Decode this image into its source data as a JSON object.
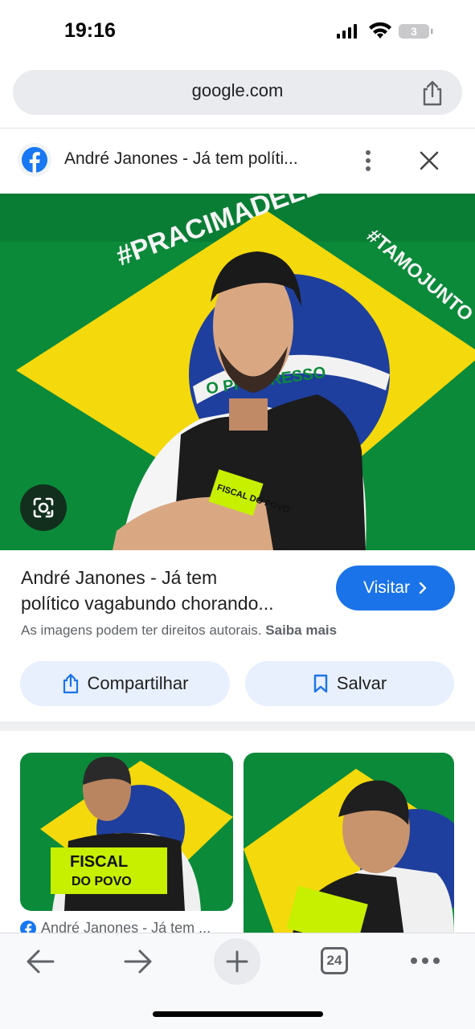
{
  "status": {
    "time": "19:16",
    "battery": "3"
  },
  "url": {
    "domain": "google.com"
  },
  "source": {
    "title": "André Janones - Já tem políti..."
  },
  "image": {
    "flag_text_1": "#PRACIMADELES",
    "flag_text_2": "#TAMOJUNTO",
    "flag_motto": "O PROGRESSO",
    "vest_text": "FISCAL DO POVO"
  },
  "result": {
    "title_line1": "André Janones - Já tem",
    "title_line2": "político vagabundo chorando...",
    "visit_label": "Visitar",
    "rights_text": "As imagens podem ter direitos autorais.",
    "learn_more": "Saiba mais"
  },
  "actions": {
    "share_label": "Compartilhar",
    "save_label": "Salvar"
  },
  "related": {
    "thumb1_source": "André Janones - Já tem ...",
    "thumb1_vest": "FISCAL",
    "thumb1_vest2": "DO POVO"
  },
  "toolbar": {
    "tabs_count": "24"
  },
  "colors": {
    "accent": "#1a73e8",
    "pill_bg": "#e8f0fe",
    "flag_green": "#0b8a3a",
    "flag_yellow": "#f4d90c",
    "flag_blue": "#1f3f9e"
  }
}
